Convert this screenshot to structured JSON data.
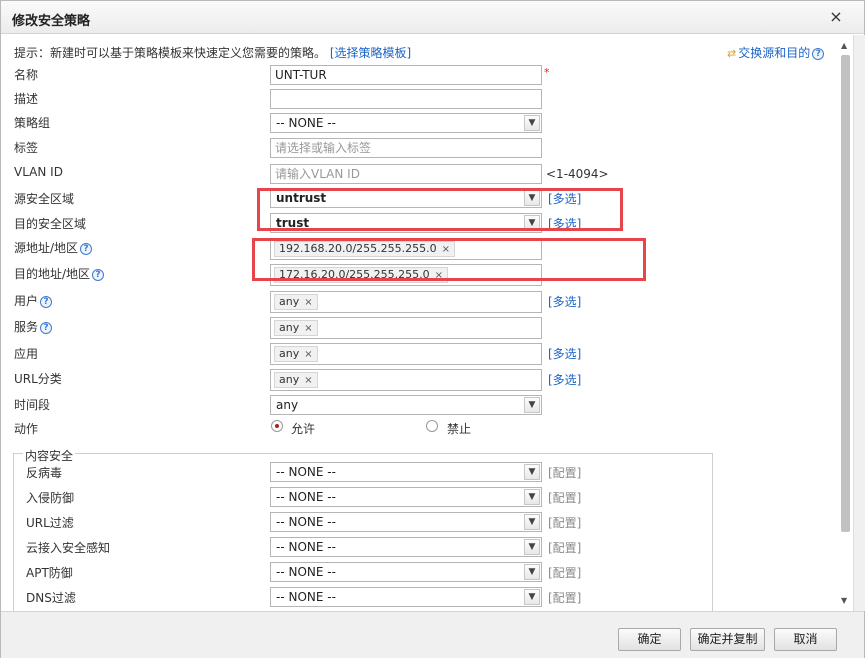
{
  "dialog": {
    "title": "修改安全策略",
    "close": "×"
  },
  "tip": {
    "text": "提示：新建时可以基于策略模板来快速定义您需要的策略。",
    "link": "[选择策略模板]"
  },
  "swap_link": "交换源和目的",
  "fields": {
    "name": {
      "label": "名称",
      "value": "UNT-TUR",
      "required": "*"
    },
    "description": {
      "label": "描述",
      "value": ""
    },
    "policy_group": {
      "label": "策略组",
      "value": "-- NONE --"
    },
    "tag": {
      "label": "标签",
      "placeholder": "请选择或输入标签"
    },
    "vlan": {
      "label": "VLAN ID",
      "placeholder": "请输入VLAN ID",
      "range": "<1-4094>"
    },
    "src_zone": {
      "label": "源安全区域",
      "value": "untrust",
      "multi": "[多选]"
    },
    "dst_zone": {
      "label": "目的安全区域",
      "value": "trust",
      "multi": "[多选]"
    },
    "src_addr": {
      "label": "源地址/地区",
      "tag": "192.168.20.0/255.255.255.0"
    },
    "dst_addr": {
      "label": "目的地址/地区",
      "tag": "172.16.20.0/255.255.255.0"
    },
    "user": {
      "label": "用户",
      "tag": "any",
      "multi": "[多选]"
    },
    "service": {
      "label": "服务",
      "tag": "any"
    },
    "application": {
      "label": "应用",
      "tag": "any",
      "multi": "[多选]"
    },
    "url_category": {
      "label": "URL分类",
      "tag": "any",
      "multi": "[多选]"
    },
    "schedule": {
      "label": "时间段",
      "value": "any"
    },
    "action": {
      "label": "动作",
      "allow": "允许",
      "deny": "禁止",
      "selected": "允许"
    }
  },
  "content_security": {
    "legend": "内容安全",
    "items": [
      {
        "label": "反病毒",
        "value": "-- NONE --",
        "config": "[配置]"
      },
      {
        "label": "入侵防御",
        "value": "-- NONE --",
        "config": "[配置]"
      },
      {
        "label": "URL过滤",
        "value": "-- NONE --",
        "config": "[配置]"
      },
      {
        "label": "云接入安全感知",
        "value": "-- NONE --",
        "config": "[配置]"
      },
      {
        "label": "APT防御",
        "value": "-- NONE --",
        "config": "[配置]"
      },
      {
        "label": "DNS过滤",
        "value": "-- NONE --",
        "config": "[配置]"
      }
    ]
  },
  "buttons": {
    "ok": "确定",
    "ok_copy": "确定并复制",
    "cancel": "取消"
  },
  "icons": {
    "help": "?",
    "tag_remove": "×",
    "dropdown": "▼",
    "swap": "⇄"
  }
}
